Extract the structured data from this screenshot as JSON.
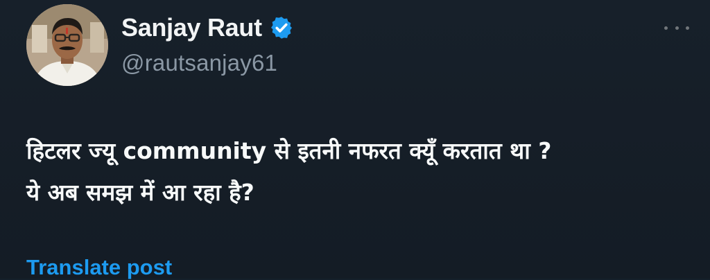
{
  "author": {
    "display_name": "Sanjay Raut",
    "handle": "@rautsanjay61",
    "verified_icon": "verified-badge-icon",
    "avatar_icon": "profile-photo"
  },
  "post": {
    "line1": "हिटलर ज्यू community से इतनी नफरत क्यूँ करतात था ?",
    "line2": "ये अब समझ में आ रहा है?",
    "translate_label": "Translate post"
  },
  "menu": {
    "more_icon": "more-options-icon"
  },
  "colors": {
    "background": "#15202b",
    "primary_text": "#f7f9f9",
    "secondary_text": "#8b98a5",
    "accent": "#1d9bf0"
  }
}
